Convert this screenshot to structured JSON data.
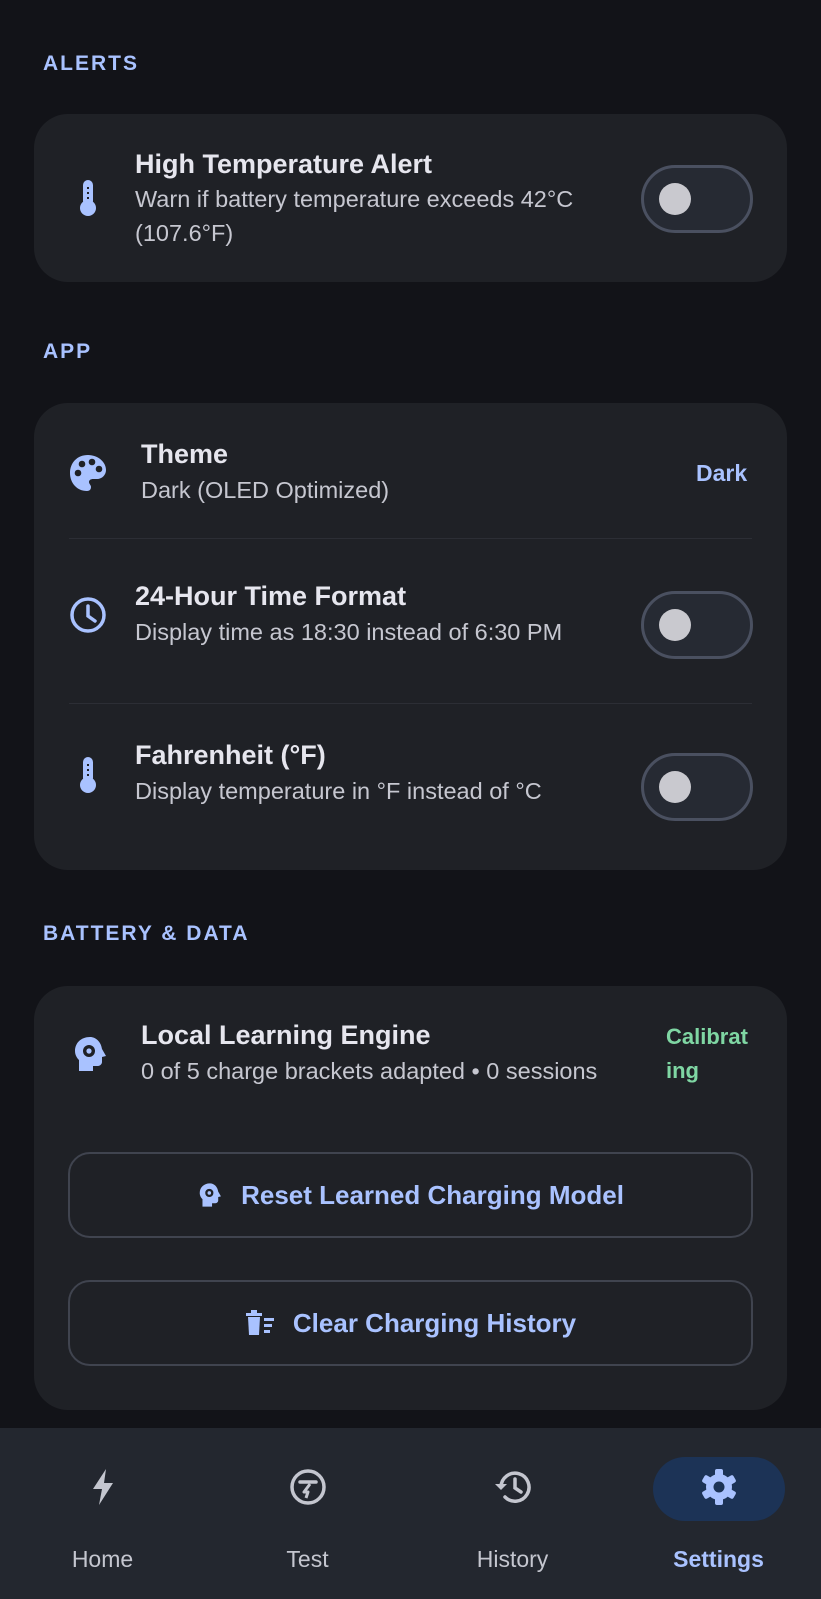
{
  "sections": {
    "alerts": "ALERTS",
    "app": "APP",
    "battery_data": "BATTERY & DATA"
  },
  "alerts": {
    "high_temp": {
      "title": "High Temperature Alert",
      "subtitle_line1": "Warn if battery temperature exceeds 42°C",
      "subtitle_line2": "(107.6°F)",
      "icon": "thermometer-icon",
      "enabled": false
    }
  },
  "app": {
    "theme": {
      "title": "Theme",
      "subtitle": "Dark (OLED Optimized)",
      "value": "Dark",
      "icon": "palette-icon"
    },
    "time_format": {
      "title": "24-Hour Time Format",
      "subtitle": "Display time as 18:30 instead of 6:30 PM",
      "icon": "clock-icon",
      "enabled": false
    },
    "fahrenheit": {
      "title": "Fahrenheit (°F)",
      "subtitle": "Display temperature in °F instead of °C",
      "icon": "thermometer-icon",
      "enabled": false
    }
  },
  "battery_data": {
    "learning_engine": {
      "title": "Local Learning Engine",
      "subtitle": "0 of 5 charge brackets adapted • 0 sessions",
      "status": "Calibrating",
      "icon": "brain-gear-icon"
    },
    "reset_button": "Reset Learned Charging Model",
    "clear_button": "Clear Charging History"
  },
  "nav": {
    "items": [
      {
        "label": "Home",
        "icon": "bolt-icon"
      },
      {
        "label": "Test",
        "icon": "speedometer-icon"
      },
      {
        "label": "History",
        "icon": "history-icon"
      },
      {
        "label": "Settings",
        "icon": "gear-icon"
      }
    ],
    "active": "Settings"
  },
  "colors": {
    "background": "#121318",
    "card": "#1f2126",
    "accent": "#a9c2ff",
    "status_green": "#7fd6a3",
    "nav_bg": "#23272f",
    "nav_active_pill": "#1c3356"
  }
}
